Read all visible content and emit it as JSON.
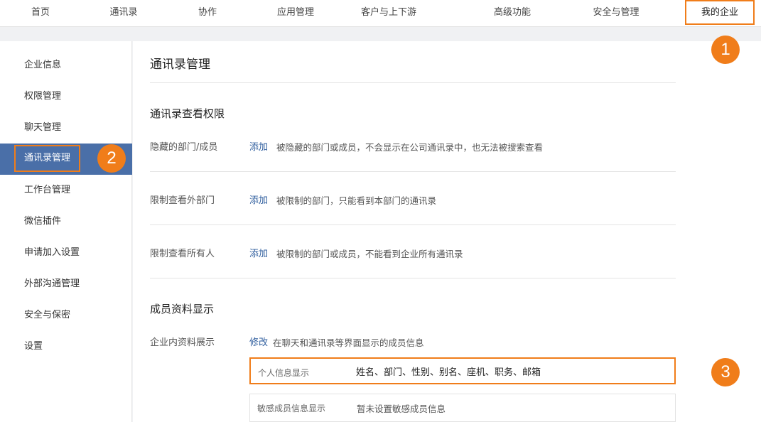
{
  "topnav": {
    "items": [
      "首页",
      "通讯录",
      "协作",
      "应用管理",
      "客户与上下游",
      "高级功能",
      "安全与管理",
      "我的企业"
    ]
  },
  "sidebar": {
    "items": [
      "企业信息",
      "权限管理",
      "聊天管理",
      "通讯录管理",
      "工作台管理",
      "微信插件",
      "申请加入设置",
      "外部沟通管理",
      "安全与保密",
      "设置"
    ]
  },
  "main": {
    "title": "通讯录管理",
    "view_permissions": {
      "title": "通讯录查看权限",
      "rows": [
        {
          "label": "隐藏的部门/成员",
          "action": "添加",
          "desc": "被隐藏的部门或成员，不会显示在公司通讯录中，也无法被搜索查看"
        },
        {
          "label": "限制查看外部门",
          "action": "添加",
          "desc": "被限制的部门，只能看到本部门的通讯录"
        },
        {
          "label": "限制查看所有人",
          "action": "添加",
          "desc": "被限制的部门或成员，不能看到企业所有通讯录"
        }
      ]
    },
    "member_display": {
      "title": "成员资料显示",
      "row": {
        "label": "企业内资料展示",
        "action": "修改",
        "desc": "在聊天和通讯录等界面显示的成员信息"
      },
      "personal": {
        "label": "个人信息显示",
        "value": "姓名、部门、性别、别名、座机、职务、邮箱"
      },
      "sensitive": {
        "label": "敏感成员信息显示",
        "value": "暂未设置敏感成员信息"
      }
    }
  },
  "badges": [
    "1",
    "2",
    "3"
  ],
  "colors": {
    "accent": "#f07d1a",
    "sidebar_active": "#4a6fa8",
    "link": "#2f5e9e"
  }
}
